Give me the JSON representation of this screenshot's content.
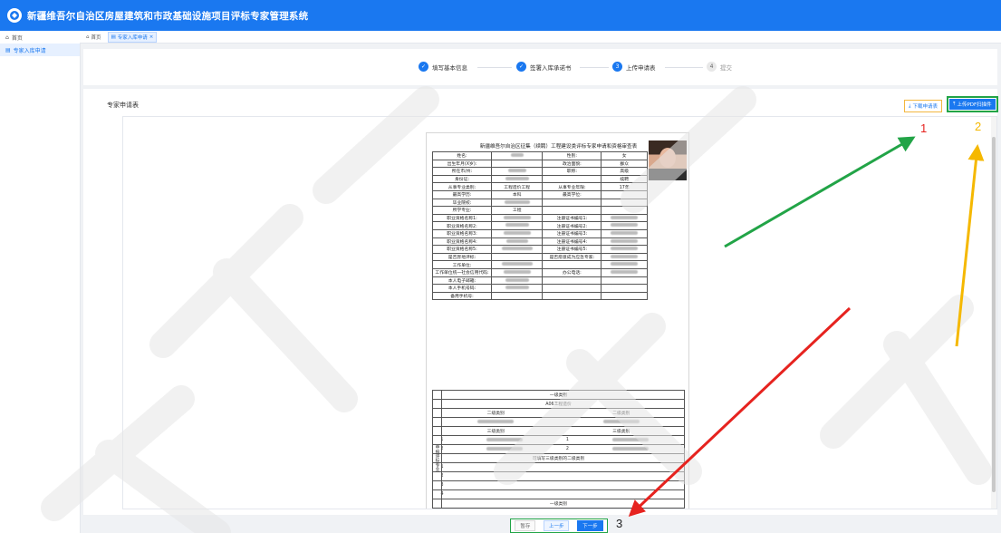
{
  "app": {
    "title": "新疆维吾尔自治区房屋建筑和市政基础设施项目评标专家管理系统"
  },
  "sidebar": {
    "items": [
      {
        "label": "首页",
        "icon": "home-icon"
      },
      {
        "label": "专家入库申请",
        "icon": "doc-icon",
        "active": true
      }
    ]
  },
  "tabs": [
    {
      "label": "首页",
      "icon": "home-icon"
    },
    {
      "label": "专家入库申请",
      "icon": "doc-icon",
      "active": true,
      "close": "×"
    }
  ],
  "steps": [
    {
      "label": "填写基本信息",
      "state": "done",
      "mark": "✓"
    },
    {
      "label": "签署入库承诺书",
      "state": "done",
      "mark": "✓"
    },
    {
      "label": "上传申请表",
      "state": "active",
      "mark": "3"
    },
    {
      "label": "提交",
      "state": "todo",
      "mark": "4"
    }
  ],
  "form": {
    "title": "专家申请表",
    "download_label": "下载申请表",
    "upload_label": "上传PDF扫描件"
  },
  "document": {
    "title": "新疆维吾尔自治区征集（续聘）工程建设类评标专家申请和资格审查表",
    "rows": [
      {
        "l1": "姓名:",
        "v1": "",
        "l2": "性别:",
        "v2": "女"
      },
      {
        "l1": "出生年月(X岁):",
        "v1": "",
        "l2": "政治面貌:",
        "v2": "群众"
      },
      {
        "l1": "所在市/州:",
        "v1": "",
        "l2": "职称:",
        "v2": "高级"
      },
      {
        "l1": "身份证:",
        "v1": "",
        "l2": "",
        "v2": "续聘"
      },
      {
        "l1": "从事专业类别:",
        "v1": "工程造价工程",
        "l2": "从事专业年限:",
        "v2": "17年"
      },
      {
        "l1": "最高学历:",
        "v1": "本科",
        "l2": "最高学位:",
        "v2": ""
      },
      {
        "l1": "毕业院校:",
        "v1": "",
        "l2": "",
        "v2": ""
      },
      {
        "l1": "所学专业:",
        "v1": "工程",
        "l2": "",
        "v2": ""
      },
      {
        "l1": "职业资格名称1:",
        "v1": "",
        "l2": "注册证书编号1:",
        "v2": ""
      },
      {
        "l1": "职业资格名称2:",
        "v1": "",
        "l2": "注册证书编号2:",
        "v2": ""
      },
      {
        "l1": "职业资格名称3:",
        "v1": "",
        "l2": "注册证书编号3:",
        "v2": ""
      },
      {
        "l1": "职业资格名称4:",
        "v1": "",
        "l2": "注册证书编号4:",
        "v2": ""
      },
      {
        "l1": "职业资格名称5:",
        "v1": "",
        "l2": "注册证书编号5:",
        "v2": ""
      },
      {
        "l1": "是否异地评标:",
        "v1": "",
        "l2": "是否愿意成为应急专家:",
        "v2": ""
      },
      {
        "l1": "工作单位:",
        "v1": "",
        "l2": "",
        "v2": ""
      },
      {
        "l1": "工作单位统一社会信用代码:",
        "v1": "",
        "l2": "办公电话:",
        "v2": ""
      },
      {
        "l1": "本人电子邮箱:",
        "v1": "",
        "l2": "",
        "v2": ""
      },
      {
        "l1": "本人手机号码:",
        "v1": "",
        "l2": "",
        "v2": ""
      },
      {
        "l1": "备用手机号:",
        "v1": "",
        "l2": "",
        "v2": ""
      }
    ],
    "side_label": "申报评标专业",
    "lower": {
      "level1": "一级类别",
      "level1_value": "A06工程造价",
      "level2": "二级类别",
      "level3": "三级类别",
      "nums": [
        "1",
        "2"
      ],
      "extra": "可填写三级类别的二级类别",
      "extra_nums": [
        "1",
        "2",
        "3",
        "4"
      ],
      "level1_bottom": "一级类别"
    }
  },
  "footer": {
    "save_label": "暂存",
    "prev_label": "上一步",
    "next_label": "下一步"
  },
  "annotations": {
    "n1": "1",
    "n2": "2",
    "n3": "3"
  },
  "watermark": {
    "text": "建设工程招标"
  },
  "colors": {
    "primary": "#1a78f0",
    "green": "#22a447",
    "orange": "#f5b800",
    "red": "#e6231f"
  }
}
